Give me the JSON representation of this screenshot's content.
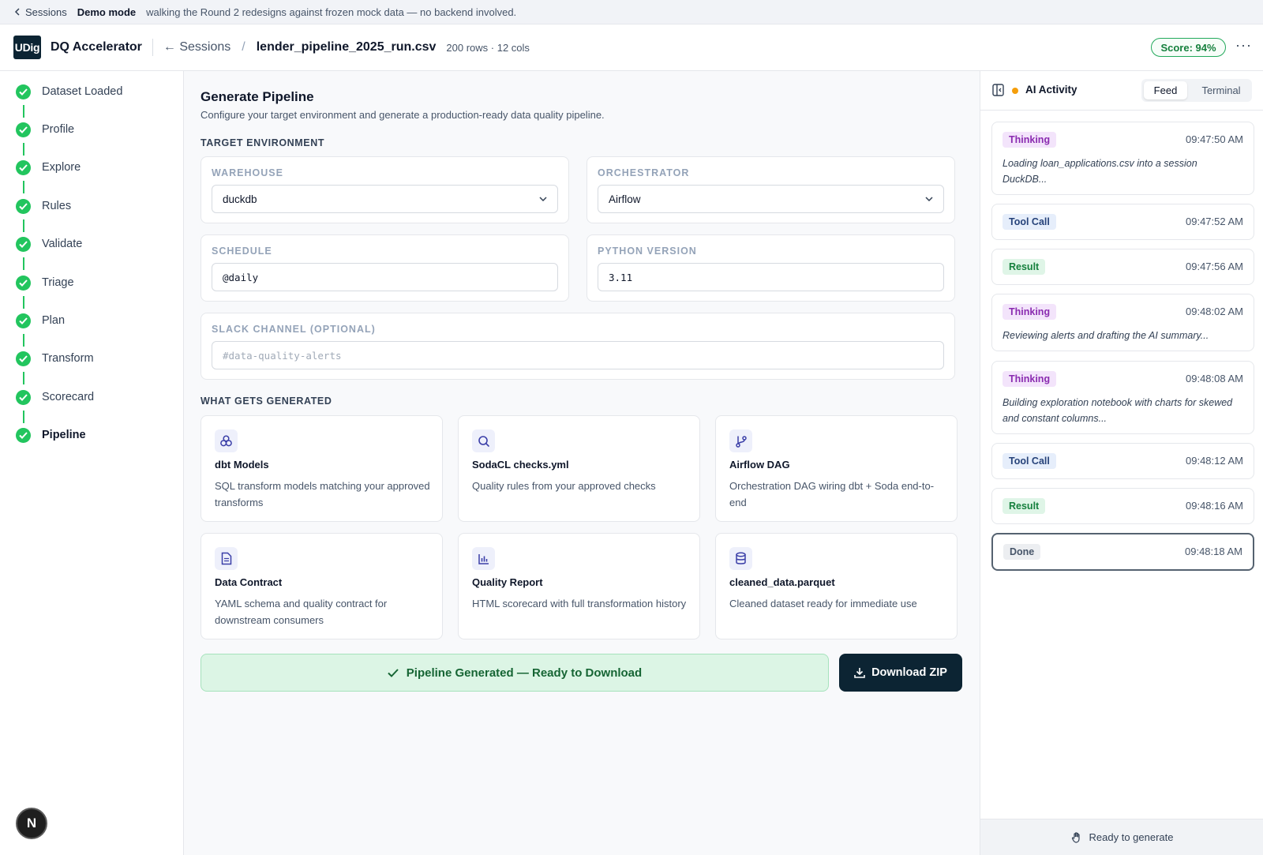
{
  "demo_bar": {
    "back_label": "Sessions",
    "mode_label": "Demo mode",
    "description": "walking the Round 2 redesigns against frozen mock data — no backend involved."
  },
  "header": {
    "logo_text": "UDig",
    "app_name": "DQ Accelerator",
    "back_label": "← Sessions",
    "separator": "/",
    "file_name": "lender_pipeline_2025_run.csv",
    "file_meta": "200 rows · 12 cols",
    "score": "Score: 94%",
    "more": "···"
  },
  "steps": [
    {
      "label": "Dataset Loaded"
    },
    {
      "label": "Profile"
    },
    {
      "label": "Explore"
    },
    {
      "label": "Rules"
    },
    {
      "label": "Validate"
    },
    {
      "label": "Triage"
    },
    {
      "label": "Plan"
    },
    {
      "label": "Transform"
    },
    {
      "label": "Scorecard"
    },
    {
      "label": "Pipeline"
    }
  ],
  "n_badge": "N",
  "main": {
    "title": "Generate Pipeline",
    "subtitle": "Configure your target environment and generate a production-ready data quality pipeline.",
    "target_env_label": "Target Environment",
    "fields": {
      "warehouse": {
        "label": "Warehouse",
        "value": "duckdb"
      },
      "orchestrator": {
        "label": "Orchestrator",
        "value": "Airflow"
      },
      "schedule": {
        "label": "Schedule",
        "value": "@daily"
      },
      "python_version": {
        "label": "Python Version",
        "value": "3.11"
      },
      "slack_channel": {
        "label": "Slack Channel (Optional)",
        "placeholder": "#data-quality-alerts"
      }
    },
    "generated_label": "What Gets Generated",
    "cards": [
      {
        "icon": "dbt-models-icon",
        "title": "dbt Models",
        "desc": "SQL transform models matching your approved transforms"
      },
      {
        "icon": "search-icon",
        "title": "SodaCL checks.yml",
        "desc": "Quality rules from your approved checks"
      },
      {
        "icon": "git-branch-icon",
        "title": "Airflow DAG",
        "desc": "Orchestration DAG wiring dbt + Soda end-to-end"
      },
      {
        "icon": "document-icon",
        "title": "Data Contract",
        "desc": "YAML schema and quality contract for downstream consumers"
      },
      {
        "icon": "bar-chart-icon",
        "title": "Quality Report",
        "desc": "HTML scorecard with full transformation history"
      },
      {
        "icon": "database-icon",
        "title": "cleaned_data.parquet",
        "desc": "Cleaned dataset ready for immediate use"
      }
    ],
    "status": "Pipeline Generated — Ready to Download",
    "download_label": "Download ZIP"
  },
  "ai_panel": {
    "title": "AI Activity",
    "tabs": {
      "feed": "Feed",
      "terminal": "Terminal"
    },
    "active_tab": "Feed",
    "events": [
      {
        "tag": "Thinking",
        "time": "09:47:50 AM",
        "text": "Loading loan_applications.csv into a session DuckDB..."
      },
      {
        "tag": "Tool Call",
        "time": "09:47:52 AM",
        "text": ""
      },
      {
        "tag": "Result",
        "time": "09:47:56 AM",
        "text": ""
      },
      {
        "tag": "Thinking",
        "time": "09:48:02 AM",
        "text": "Reviewing alerts and drafting the AI summary..."
      },
      {
        "tag": "Thinking",
        "time": "09:48:08 AM",
        "text": "Building exploration notebook with charts for skewed and constant columns..."
      },
      {
        "tag": "Tool Call",
        "time": "09:48:12 AM",
        "text": ""
      },
      {
        "tag": "Result",
        "time": "09:48:16 AM",
        "text": ""
      },
      {
        "tag": "Done",
        "time": "09:48:18 AM",
        "text": ""
      }
    ],
    "footer": "Ready to generate"
  },
  "colors": {
    "accent_dark": "#0c2433",
    "step_complete": "#22c55e",
    "score_green": "#15803d",
    "status_dot": "#f59e0b"
  }
}
